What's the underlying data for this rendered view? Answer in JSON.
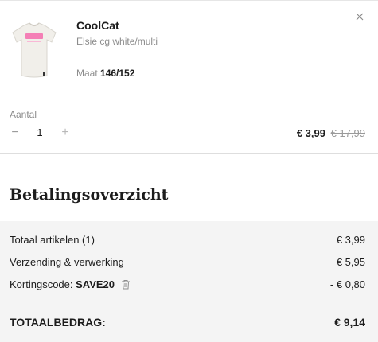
{
  "cart_item": {
    "brand": "CoolCat",
    "variant": "Elsie cg white/multi",
    "size_label": "Maat",
    "size_value": "146/152",
    "quantity_label": "Aantal",
    "quantity": "1",
    "price_now": "€ 3,99",
    "price_old": "€ 17,99",
    "image_icon": "tshirt-thumbnail",
    "close_icon": "close-icon"
  },
  "summary": {
    "title": "Betalingsoverzicht",
    "rows": [
      {
        "label": "Totaal artikelen (1)",
        "amount": "€ 3,99"
      },
      {
        "label": "Verzending & verwerking",
        "amount": "€ 5,95"
      },
      {
        "label": "Kortingscode:",
        "code": "SAVE20",
        "amount": "- € 0,80"
      }
    ],
    "total_label": "TOTAALBEDRAG:",
    "total_amount": "€ 9,14"
  },
  "colors": {
    "muted_text": "#8c8c8c",
    "summary_background": "#f4f4f4",
    "tshirt_print": "#f47fb6"
  }
}
